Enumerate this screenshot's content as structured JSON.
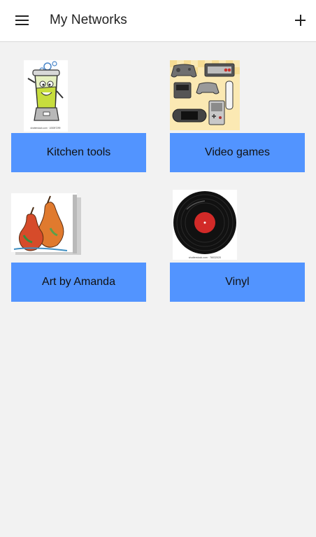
{
  "header": {
    "title": "My Networks",
    "menu_icon": "hamburger-menu-icon",
    "add_icon": "plus-icon"
  },
  "networks": [
    {
      "label": "Kitchen tools",
      "image": "blender-cartoon-image",
      "caption": "shutterstock.com · 105097299"
    },
    {
      "label": "Video games",
      "image": "game-controllers-image"
    },
    {
      "label": "Art by Amanda",
      "image": "pears-painting-image",
      "caption": ""
    },
    {
      "label": "Vinyl",
      "image": "vinyl-record-image",
      "caption": "shutterstock.com · 76032020"
    }
  ],
  "colors": {
    "button": "#5294ff",
    "background": "#f2f2f2",
    "header": "#ffffff"
  }
}
